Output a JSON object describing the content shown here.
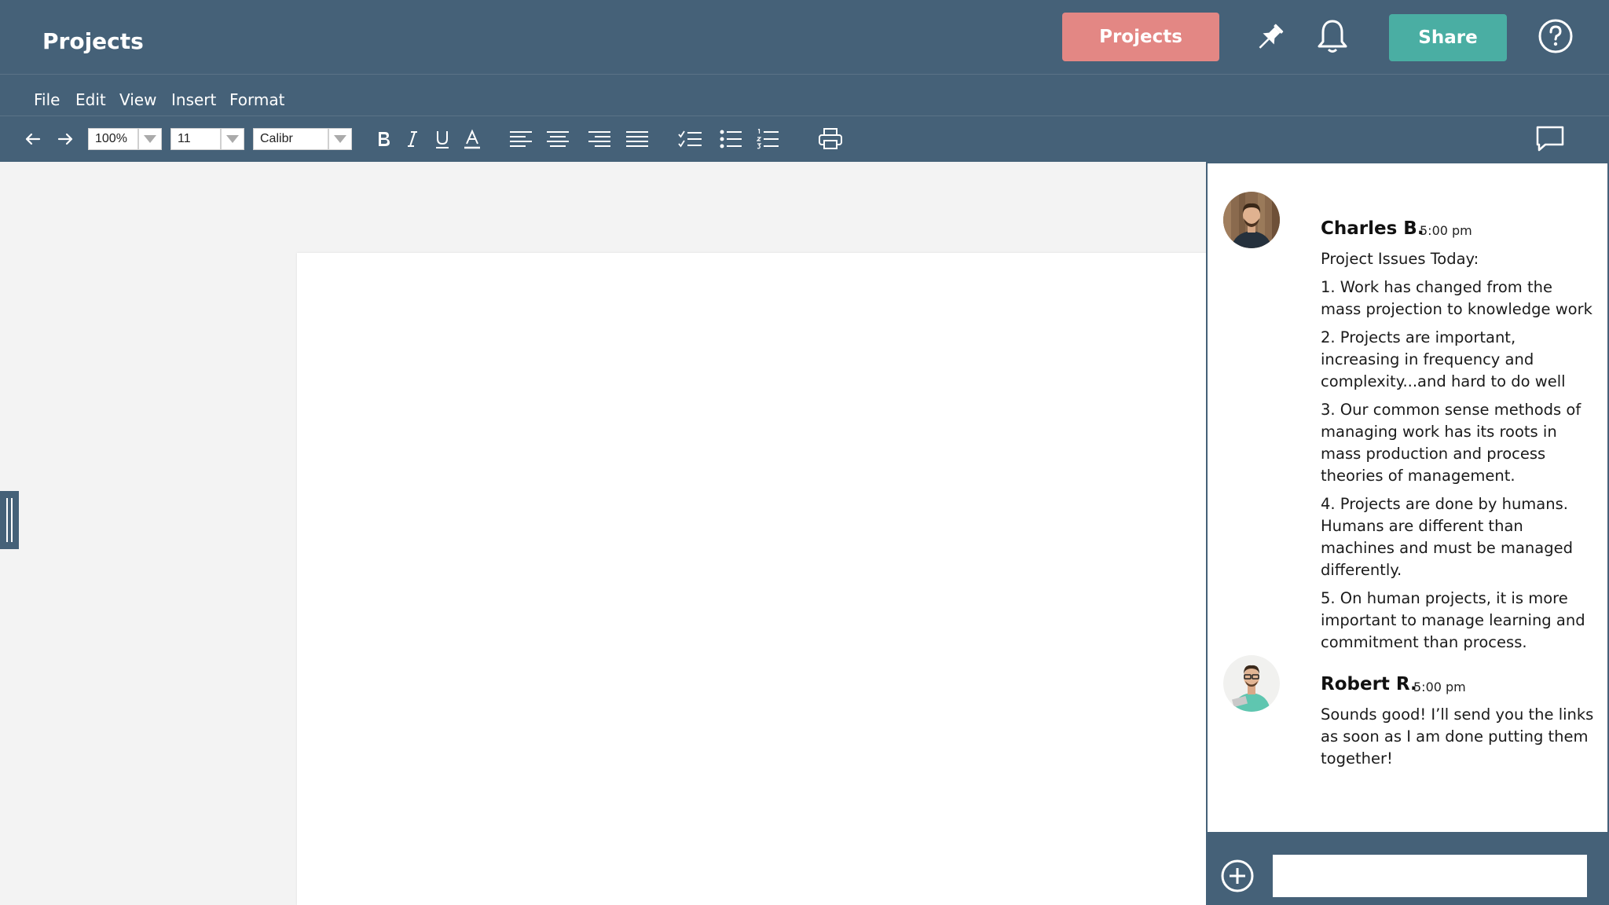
{
  "header": {
    "title": "Projects",
    "projects_button": "Projects",
    "share_button": "Share",
    "icons": [
      "pin-icon",
      "bell-icon",
      "help-icon"
    ]
  },
  "menu": {
    "items": [
      "File",
      "Edit",
      "View",
      "Insert",
      "Format"
    ]
  },
  "toolbar": {
    "zoom": "100%",
    "font_size": "11",
    "font_family": "Calibr",
    "icons": [
      "undo-icon",
      "redo-icon",
      "bold-icon",
      "italic-icon",
      "underline-icon",
      "text-color-icon",
      "align-left-icon",
      "align-center-icon",
      "align-right-icon",
      "align-justify-icon",
      "checklist-icon",
      "bullet-list-icon",
      "numbered-list-icon",
      "print-icon",
      "comment-icon"
    ]
  },
  "comments": [
    {
      "author": "Charles B.",
      "time": "5:00 pm",
      "paragraphs": [
        "Project Issues Today:",
        "1. Work has changed from the mass projection to knowledge work",
        "2. Projects are important, increasing in frequency and complexity...and hard to do well",
        "3. Our common sense methods of managing work has its roots in mass production and process theories of management.",
        "4. Projects are done by humans. Humans are different than machines and must be managed differently.",
        "5. On human projects, it is more important to manage learning and commitment than process."
      ]
    },
    {
      "author": "Robert R.",
      "time": "5:00 pm",
      "paragraphs": [
        "Sounds good! I’ll send you the links as soon as I am done putting them together!"
      ]
    }
  ],
  "composer": {
    "placeholder": "",
    "value": ""
  },
  "colors": {
    "bar": "#456178",
    "projects_button": "#e38784",
    "share_button": "#4aaea3",
    "canvas": "#f3f3f3"
  }
}
